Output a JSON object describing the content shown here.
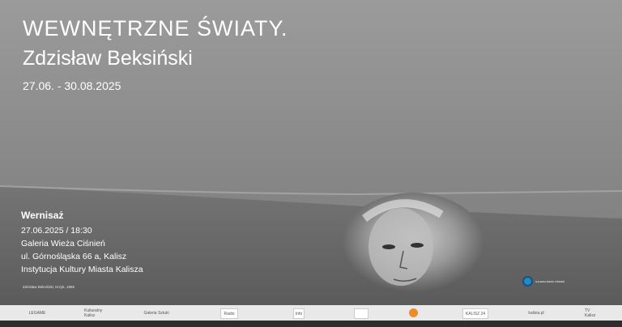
{
  "title": {
    "line1": "WEWNĘTRZNE ŚWIATY.",
    "line2": "Zdzisław Beksiński",
    "dates": "27.06. - 30.08.2025"
  },
  "opening": {
    "heading": "Wernisaż",
    "lines": [
      "27.06.2025 / 18:30",
      "Galeria Wieża Ciśnień",
      "ul. Górnośląska 66 a, Kalisz",
      "Instytucja Kultury Miasta Kalisza"
    ]
  },
  "credit": "Zdzisław Beksiński, Krzyk, 1955",
  "organizer_logo_text": "GALERIA WIEŻA CIŚNIEŃ",
  "partners": [
    "LEGAME",
    "Kulturalny Kalisz",
    "Galeria Sztuki",
    "Radio",
    "Info",
    "",
    "",
    "KALISZ 24",
    "kalisia.pl",
    "TV Kalisz"
  ],
  "colors": {
    "accent_blue": "#1b8ccc",
    "text": "#ffffff",
    "strip": "#e9e9e9"
  }
}
